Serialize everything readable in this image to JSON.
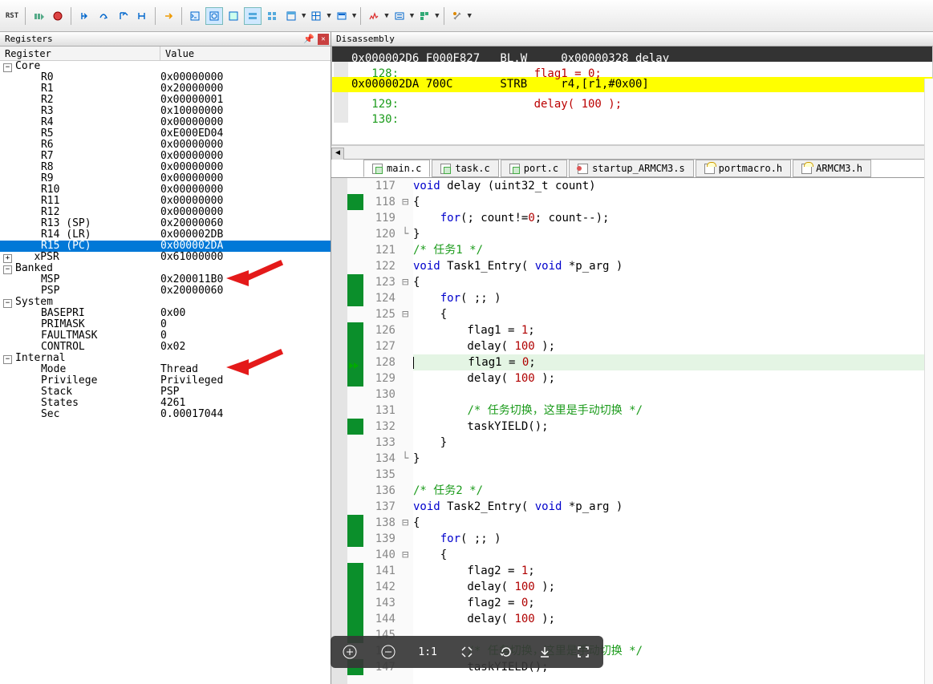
{
  "toolbar": {
    "rst_label": "RST"
  },
  "registers_panel": {
    "title": "Registers",
    "col_name": "Register",
    "col_value": "Value",
    "groups": {
      "core": "Core",
      "banked": "Banked",
      "system": "System",
      "internal": "Internal"
    },
    "core": [
      {
        "n": "R0",
        "v": "0x00000000"
      },
      {
        "n": "R1",
        "v": "0x20000000"
      },
      {
        "n": "R2",
        "v": "0x00000001"
      },
      {
        "n": "R3",
        "v": "0x10000000"
      },
      {
        "n": "R4",
        "v": "0x00000000"
      },
      {
        "n": "R5",
        "v": "0xE000ED04"
      },
      {
        "n": "R6",
        "v": "0x00000000"
      },
      {
        "n": "R7",
        "v": "0x00000000"
      },
      {
        "n": "R8",
        "v": "0x00000000"
      },
      {
        "n": "R9",
        "v": "0x00000000"
      },
      {
        "n": "R10",
        "v": "0x00000000"
      },
      {
        "n": "R11",
        "v": "0x00000000"
      },
      {
        "n": "R12",
        "v": "0x00000000"
      },
      {
        "n": "R13 (SP)",
        "v": "0x20000060"
      },
      {
        "n": "R14 (LR)",
        "v": "0x000002DB"
      },
      {
        "n": "R15 (PC)",
        "v": "0x000002DA"
      },
      {
        "n": "xPSR",
        "v": "0x61000000"
      }
    ],
    "banked": [
      {
        "n": "MSP",
        "v": "0x200011B0"
      },
      {
        "n": "PSP",
        "v": "0x20000060"
      }
    ],
    "system": [
      {
        "n": "BASEPRI",
        "v": "0x00"
      },
      {
        "n": "PRIMASK",
        "v": "0"
      },
      {
        "n": "FAULTMASK",
        "v": "0"
      },
      {
        "n": "CONTROL",
        "v": "0x02"
      }
    ],
    "internal": [
      {
        "n": "Mode",
        "v": "Thread"
      },
      {
        "n": "Privilege",
        "v": "Privileged"
      },
      {
        "n": "Stack",
        "v": "PSP"
      },
      {
        "n": "States",
        "v": "4261"
      },
      {
        "n": "Sec",
        "v": "0.00017044"
      }
    ]
  },
  "disasm_panel": {
    "title": "Disassembly",
    "lines": [
      {
        "addr": "0x000002D6",
        "bytes": "F000F827",
        "mnem": "BL.W",
        "args": "0x00000328 delay"
      },
      {
        "src": "   128:                  flag1 = 0;"
      },
      {
        "addr": "0x000002DA",
        "bytes": "700C",
        "mnem": "STRB",
        "args": "r4,[r1,#0x00]"
      },
      {
        "src": "   129:                  delay( 100 );"
      },
      {
        "src": "   130:"
      }
    ]
  },
  "filetabs": [
    {
      "name": "main.c",
      "type": "c",
      "active": true
    },
    {
      "name": "task.c",
      "type": "c"
    },
    {
      "name": "port.c",
      "type": "c"
    },
    {
      "name": "startup_ARMCM3.s",
      "type": "s"
    },
    {
      "name": "portmacro.h",
      "type": "h"
    },
    {
      "name": "ARMCM3.h",
      "type": "h"
    }
  ],
  "editor": {
    "lines": [
      {
        "n": 117,
        "m": "",
        "f": "",
        "raw": "void delay (uint32_t count)",
        "tok": [
          [
            "kw",
            "void"
          ],
          [
            "",
            " delay (uint32_t count)"
          ]
        ]
      },
      {
        "n": 118,
        "m": "g",
        "f": "⊟",
        "raw": "{",
        "tok": [
          [
            "",
            "{"
          ]
        ]
      },
      {
        "n": 119,
        "m": "",
        "f": "",
        "raw": "    for(; count!=0; count--);",
        "tok": [
          [
            "",
            "    "
          ],
          [
            "kw",
            "for"
          ],
          [
            "",
            "(; count!="
          ],
          [
            "num",
            "0"
          ],
          [
            "",
            "; count--);"
          ]
        ]
      },
      {
        "n": 120,
        "m": "",
        "f": "└",
        "raw": "}",
        "tok": [
          [
            "",
            "}"
          ]
        ]
      },
      {
        "n": 121,
        "m": "",
        "f": "",
        "raw": "/* 任务1 */",
        "tok": [
          [
            "cmt",
            "/* 任务1 */"
          ]
        ]
      },
      {
        "n": 122,
        "m": "",
        "f": "",
        "raw": "void Task1_Entry( void *p_arg )",
        "tok": [
          [
            "kw",
            "void"
          ],
          [
            "",
            " Task1_Entry( "
          ],
          [
            "kw",
            "void"
          ],
          [
            "",
            " *p_arg )"
          ]
        ]
      },
      {
        "n": 123,
        "m": "g",
        "f": "⊟",
        "raw": "{",
        "tok": [
          [
            "",
            "{"
          ]
        ]
      },
      {
        "n": 124,
        "m": "g",
        "f": "",
        "raw": "    for( ;; )",
        "tok": [
          [
            "",
            "    "
          ],
          [
            "kw",
            "for"
          ],
          [
            "",
            "( ;; )"
          ]
        ]
      },
      {
        "n": 125,
        "m": "",
        "f": "⊟",
        "raw": "    {",
        "tok": [
          [
            "",
            "    {"
          ]
        ]
      },
      {
        "n": 126,
        "m": "g",
        "f": "",
        "raw": "        flag1 = 1;",
        "tok": [
          [
            "",
            "        flag1 = "
          ],
          [
            "num",
            "1"
          ],
          [
            "",
            ";"
          ]
        ]
      },
      {
        "n": 127,
        "m": "g",
        "f": "",
        "raw": "        delay( 100 );",
        "tok": [
          [
            "",
            "        delay( "
          ],
          [
            "num",
            "100"
          ],
          [
            "",
            " );"
          ]
        ]
      },
      {
        "n": 128,
        "m": "pc",
        "f": "",
        "raw": "        flag1 = 0;",
        "cur": true,
        "tok": [
          [
            "",
            "        flag1 = "
          ],
          [
            "num",
            "0"
          ],
          [
            "",
            ";"
          ]
        ]
      },
      {
        "n": 129,
        "m": "g",
        "f": "",
        "raw": "        delay( 100 );",
        "tok": [
          [
            "",
            "        delay( "
          ],
          [
            "num",
            "100"
          ],
          [
            "",
            " );"
          ]
        ]
      },
      {
        "n": 130,
        "m": "",
        "f": "",
        "raw": "",
        "tok": [
          [
            "",
            ""
          ]
        ]
      },
      {
        "n": 131,
        "m": "",
        "f": "",
        "raw": "        /* 任务切换，这里是手动切换 */",
        "tok": [
          [
            "",
            "        "
          ],
          [
            "cmt",
            "/* 任务切换，这里是手动切换 */"
          ]
        ]
      },
      {
        "n": 132,
        "m": "g",
        "f": "",
        "raw": "        taskYIELD();",
        "tok": [
          [
            "",
            "        taskYIELD();"
          ]
        ]
      },
      {
        "n": 133,
        "m": "",
        "f": "",
        "raw": "    }",
        "tok": [
          [
            "",
            "    }"
          ]
        ]
      },
      {
        "n": 134,
        "m": "",
        "f": "└",
        "raw": "}",
        "tok": [
          [
            "",
            "}"
          ]
        ]
      },
      {
        "n": 135,
        "m": "",
        "f": "",
        "raw": "",
        "tok": [
          [
            "",
            ""
          ]
        ]
      },
      {
        "n": 136,
        "m": "",
        "f": "",
        "raw": "/* 任务2 */",
        "tok": [
          [
            "cmt",
            "/* 任务2 */"
          ]
        ]
      },
      {
        "n": 137,
        "m": "",
        "f": "",
        "raw": "void Task2_Entry( void *p_arg )",
        "tok": [
          [
            "kw",
            "void"
          ],
          [
            "",
            " Task2_Entry( "
          ],
          [
            "kw",
            "void"
          ],
          [
            "",
            " *p_arg )"
          ]
        ]
      },
      {
        "n": 138,
        "m": "g",
        "f": "⊟",
        "raw": "{",
        "tok": [
          [
            "",
            "{"
          ]
        ]
      },
      {
        "n": 139,
        "m": "g",
        "f": "",
        "raw": "    for( ;; )",
        "tok": [
          [
            "",
            "    "
          ],
          [
            "kw",
            "for"
          ],
          [
            "",
            "( ;; )"
          ]
        ]
      },
      {
        "n": 140,
        "m": "",
        "f": "⊟",
        "raw": "    {",
        "tok": [
          [
            "",
            "    {"
          ]
        ]
      },
      {
        "n": 141,
        "m": "g",
        "f": "",
        "raw": "        flag2 = 1;",
        "tok": [
          [
            "",
            "        flag2 = "
          ],
          [
            "num",
            "1"
          ],
          [
            "",
            ";"
          ]
        ]
      },
      {
        "n": 142,
        "m": "g",
        "f": "",
        "raw": "        delay( 100 );",
        "tok": [
          [
            "",
            "        delay( "
          ],
          [
            "num",
            "100"
          ],
          [
            "",
            " );"
          ]
        ]
      },
      {
        "n": 143,
        "m": "g",
        "f": "",
        "raw": "        flag2 = 0;",
        "tok": [
          [
            "",
            "        flag2 = "
          ],
          [
            "num",
            "0"
          ],
          [
            "",
            ";"
          ]
        ]
      },
      {
        "n": 144,
        "m": "g",
        "f": "",
        "raw": "        delay( 100 );",
        "tok": [
          [
            "",
            "        delay( "
          ],
          [
            "num",
            "100"
          ],
          [
            "",
            " );"
          ]
        ]
      },
      {
        "n": 145,
        "m": "g",
        "f": "",
        "raw": "        ",
        "tok": [
          [
            "",
            "        "
          ]
        ]
      },
      {
        "n": 146,
        "m": "",
        "f": "",
        "raw": "        /* 任务切换，这里是手动切换 */",
        "tok": [
          [
            "",
            "        "
          ],
          [
            "cmt",
            "/* 任务切换，这里是手动切换 */"
          ]
        ]
      },
      {
        "n": 147,
        "m": "g",
        "f": "",
        "raw": "        taskYIELD();",
        "tok": [
          [
            "",
            "        taskYIELD();"
          ]
        ]
      }
    ]
  },
  "viewer": {
    "ratio": "1:1"
  },
  "xpsr_toggle": "+"
}
